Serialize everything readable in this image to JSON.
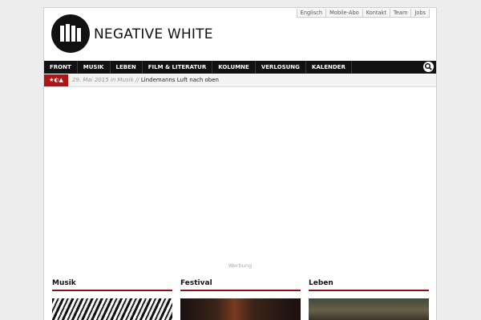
{
  "top_links": [
    "Englisch",
    "Mobile-Abo",
    "Kontakt",
    "Team",
    "Jobs"
  ],
  "site": {
    "name": "NEGATIVE WHITE"
  },
  "nav": {
    "items": [
      "FRONT",
      "MUSIK",
      "LEBEN",
      "FILM & LITERATUR",
      "KOLUMNE",
      "VERLOSUNG",
      "KALENDER"
    ]
  },
  "ticker": {
    "date": "29. Mai 2015",
    "in": "in",
    "category": "Musik",
    "separator": "//",
    "headline": "Lindemanns Luft nach oben"
  },
  "ad": {
    "label": "Werbung"
  },
  "sections": [
    {
      "title": "Musik"
    },
    {
      "title": "Festival"
    },
    {
      "title": "Leben"
    }
  ],
  "colors": {
    "nav_bg": "#121212",
    "accent_red": "#8a1010",
    "ticker_badge": "#b01515"
  },
  "icons": {
    "search": "search-icon",
    "logo": "logo-icon"
  }
}
